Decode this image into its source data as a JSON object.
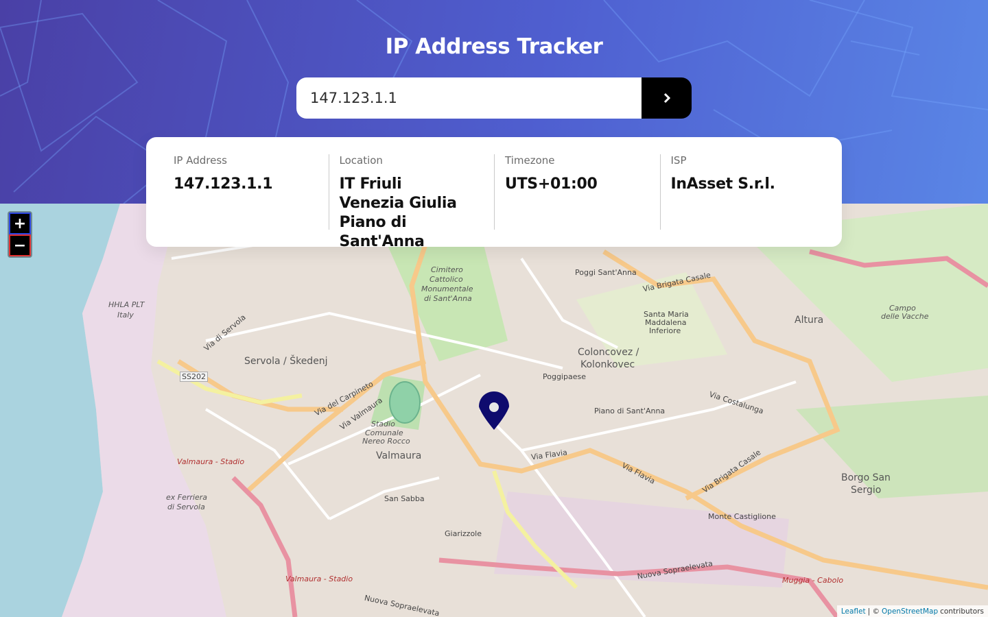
{
  "app": {
    "title": "IP Address Tracker"
  },
  "search": {
    "value": "147.123.1.1",
    "button_icon": "chevron-right-icon"
  },
  "info": {
    "ip": {
      "label": "IP Address",
      "value": "147.123.1.1"
    },
    "location": {
      "label": "Location",
      "value": "IT Friuli Venezia Giulia Piano di Sant'Anna"
    },
    "timezone": {
      "label": "Timezone",
      "value": "UTS+01:00"
    },
    "isp": {
      "label": "ISP",
      "value": "InAsset S.r.l."
    }
  },
  "map": {
    "zoom_in_label": "+",
    "zoom_out_label": "−",
    "marker_icon": "location-pin-icon",
    "attribution": {
      "leaflet": "Leaflet",
      "separator": "| ©",
      "osm": "OpenStreetMap",
      "suffix": "contributors"
    },
    "labels": {
      "servola": "Servola / Škedenj",
      "valmaura": "Valmaura",
      "coloncovez": "Coloncovez /",
      "kolonkovec": "Kolonkovec",
      "altura": "Altura",
      "borgo_san": "Borgo San",
      "sergio": "Sergio",
      "poggipaese": "Poggipaese",
      "piano": "Piano di Sant'Anna",
      "cimitero": "Cimitero",
      "cattolico": "Cattolico",
      "monumentale": "Monumentale",
      "di_santanna": "di Sant'Anna",
      "stadio": "Stadio",
      "comunale": "Comunale",
      "nereo_rocco": "Nereo Rocco",
      "san_sabba": "San Sabba",
      "giarizzole": "Giarizzole",
      "monte_castiglione": "Monte Castiglione",
      "hhla": "HHLA PLT",
      "italy": "Italy",
      "ferriera": "ex Ferriera",
      "di_servola": "di Servola",
      "santa_maria": "Santa Maria",
      "maddalena": "Maddalena",
      "inferiore": "Inferiore",
      "poggi_santanna": "Poggi Sant'Anna",
      "campo": "Campo",
      "delle_vacche": "delle Vacche",
      "valmaura_stadio": "Valmaura - Stadio",
      "via_flavia": "Via Flavia",
      "via_valmaura": "Via Valmaura",
      "via_brigata_casale": "Via Brigata Casale",
      "via_costalunga": "Via Costalunga",
      "nuova_sopraelevata": "Nuova Sopraelevata",
      "via_del_carpineto": "Via del Carpineto",
      "via_di_servola": "Via di Servola",
      "ss202": "SS202",
      "muggia_cabolo": "Muggia - Cabolo"
    }
  }
}
